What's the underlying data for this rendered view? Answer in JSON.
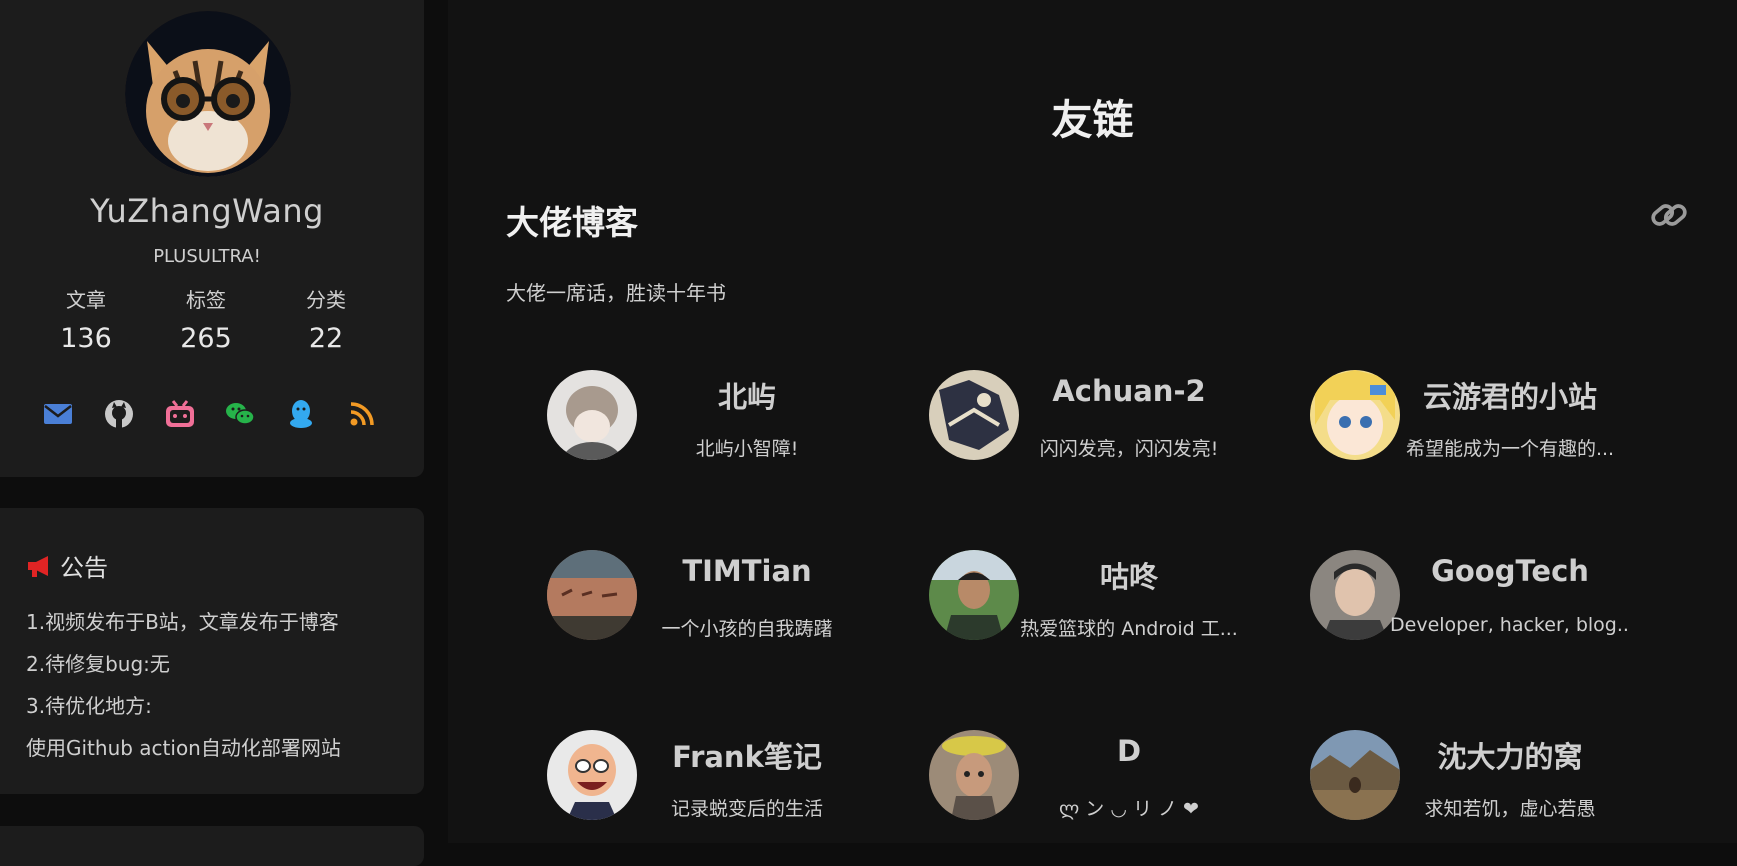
{
  "sidebar": {
    "author": {
      "name": "YuZhangWang",
      "description": "PLUSULTRA!"
    },
    "stats": [
      {
        "label": "文章",
        "value": "136"
      },
      {
        "label": "标签",
        "value": "265"
      },
      {
        "label": "分类",
        "value": "22"
      }
    ],
    "socials": [
      {
        "icon": "mail-icon",
        "color": "#4a7fd6"
      },
      {
        "icon": "github-icon",
        "color": "#c8c8c8"
      },
      {
        "icon": "bilibili-icon",
        "color": "#f06f97"
      },
      {
        "icon": "wechat-icon",
        "color": "#26b34a"
      },
      {
        "icon": "qq-icon",
        "color": "#33a9f0"
      },
      {
        "icon": "rss-icon",
        "color": "#f29a24"
      }
    ],
    "announcement": {
      "title": "公告",
      "icon_color": "#e02424",
      "lines": [
        "1.视频发布于B站，文章发布于博客",
        "2.待修复bug:无",
        "3.待优化地方:",
        "使用Github action自动化部署网站"
      ]
    }
  },
  "main": {
    "title": "友链",
    "section": {
      "title": "大佬博客",
      "description": "大佬一席话，胜读十年书"
    },
    "friends": [
      {
        "name": "北屿",
        "desc": "北屿小智障!"
      },
      {
        "name": "Achuan-2",
        "desc": "闪闪发亮，闪闪发亮!"
      },
      {
        "name": "云游君的小站",
        "desc": "希望能成为一个有趣的..."
      },
      {
        "name": "TIMTian",
        "desc": "一个小孩的自我踌躇"
      },
      {
        "name": "咕咚",
        "desc": "热爱篮球的 Android 工..."
      },
      {
        "name": "GoogTech",
        "desc": "Developer, hacker, blog..."
      },
      {
        "name": "Frank笔记",
        "desc": "记录蜕变后的生活"
      },
      {
        "name": "D",
        "desc": "ლ ン ◡ リ ノ ❤"
      },
      {
        "name": "沈大力的窝",
        "desc": "求知若饥，虚心若愚"
      }
    ]
  }
}
